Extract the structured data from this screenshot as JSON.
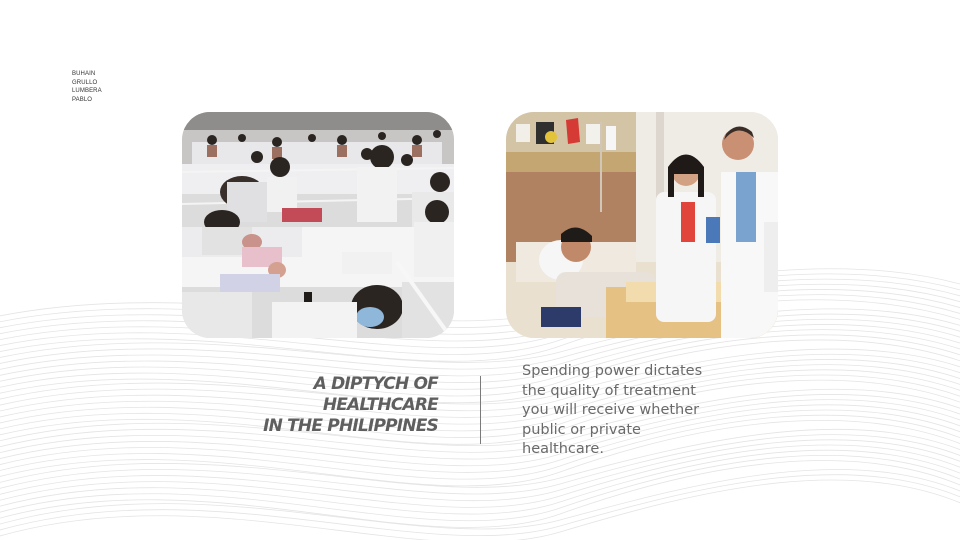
{
  "slide": {
    "authors": [
      "BUHAIN",
      "GRULLO",
      "LUMBERA",
      "PABLO"
    ],
    "title_lines": [
      "A DIPTYCH OF",
      "HEALTHCARE",
      "IN THE PHILIPPINES"
    ],
    "description_lines": [
      "Spending power dictates",
      "the quality of treatment",
      "you will receive whether",
      "public or private",
      "healthcare."
    ],
    "images": {
      "left": "crowded-public-hospital-ward-photo",
      "right": "private-hospital-room-photo"
    },
    "colors": {
      "title": "#5f5f5f",
      "description": "#6a6a6a",
      "divider": "#7a7a7a",
      "background": "#ffffff"
    }
  }
}
